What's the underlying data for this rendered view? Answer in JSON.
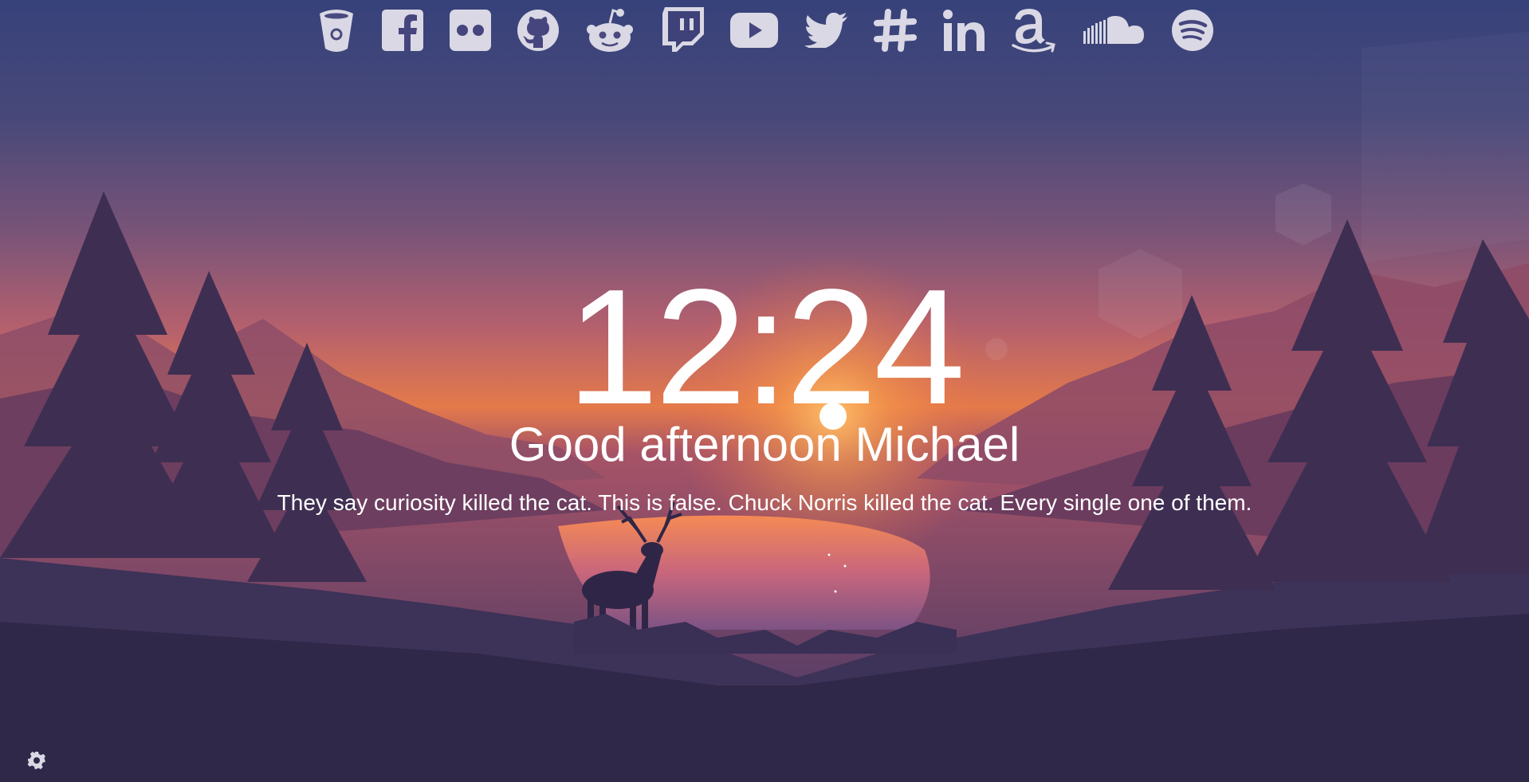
{
  "clock": {
    "time": "12:24"
  },
  "greeting": {
    "text": "Good afternoon Michael"
  },
  "quote": {
    "text": "They say curiosity killed the cat. This is false. Chuck Norris killed the cat. Every single one of them."
  },
  "links": [
    {
      "icon": "bitbucket-icon"
    },
    {
      "icon": "facebook-icon"
    },
    {
      "icon": "flickr-icon"
    },
    {
      "icon": "github-icon"
    },
    {
      "icon": "reddit-icon"
    },
    {
      "icon": "twitch-icon"
    },
    {
      "icon": "youtube-icon"
    },
    {
      "icon": "twitter-icon"
    },
    {
      "icon": "slack-icon"
    },
    {
      "icon": "linkedin-icon"
    },
    {
      "icon": "amazon-icon"
    },
    {
      "icon": "soundcloud-icon"
    },
    {
      "icon": "spotify-icon"
    }
  ],
  "settings": {
    "icon": "gear-icon"
  },
  "colors": {
    "sky_top": "#3a4478",
    "sky_mid": "#b1606e",
    "horizon": "#f0803e",
    "silhouette": "#2e2748",
    "icon": "#d9d8e4",
    "text": "#ffffff"
  }
}
